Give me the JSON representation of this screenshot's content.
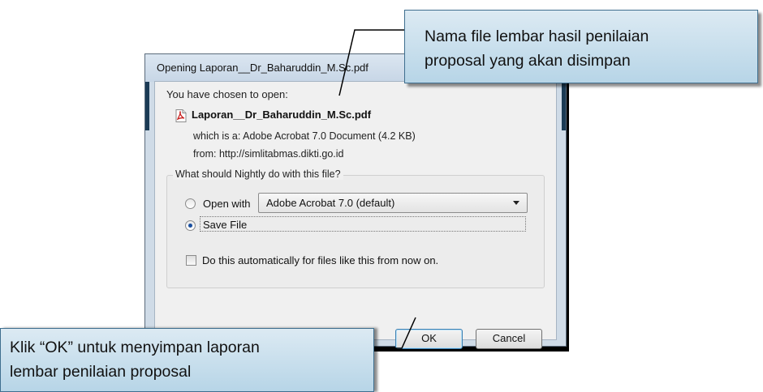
{
  "dialog": {
    "title": "Opening Laporan__Dr_Baharuddin_M.Sc.pdf",
    "chosen_label": "You have chosen to open:",
    "file_name": "Laporan__Dr_Baharuddin_M.Sc.pdf",
    "which_line": "which is a: Adobe Acrobat 7.0 Document (4.2 KB)",
    "from_line": "from: http://simlitabmas.dikti.go.id",
    "group_label": "What should Nightly do with this file?",
    "open_with_label": "Open with",
    "open_with_app": "Adobe Acrobat 7.0 (default)",
    "save_file_label": "Save File",
    "selected_action": "Save File",
    "auto_checkbox_label": "Do this automatically for files like this from now on.",
    "auto_checked": false,
    "ok_label": "OK",
    "cancel_label": "Cancel",
    "file_icon": "pdf-icon"
  },
  "callouts": {
    "top_line1": "Nama file lembar hasil penilaian",
    "top_line2": "proposal yang akan disimpan",
    "bottom_line1": "Klik “OK” untuk menyimpan laporan",
    "bottom_line2": "lembar penilaian proposal"
  },
  "colors": {
    "callout_fill": "#b7d5e7",
    "radio_selected": "#1a4fa0",
    "pdf_icon_red": "#c8201e"
  }
}
